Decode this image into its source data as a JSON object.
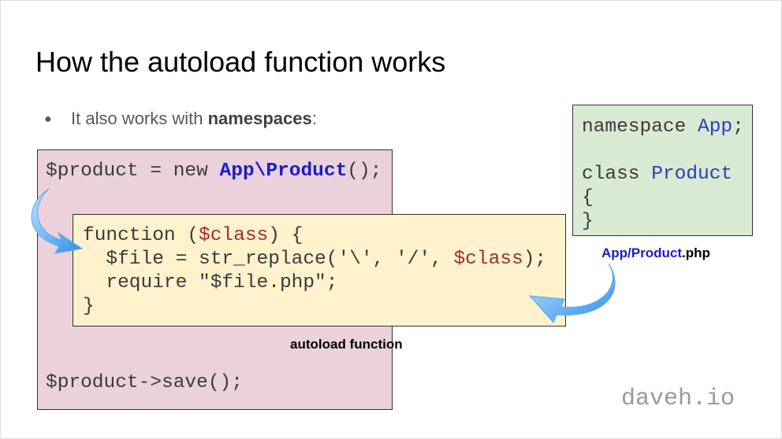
{
  "title": "How the autoload function works",
  "bullet": {
    "text": "It also works with ",
    "bold": "namespaces",
    "suffix": ":"
  },
  "caller": {
    "line1_a": "$product = new ",
    "line1_b": "App\\Product",
    "line1_c": "();",
    "line2": "$product->save();"
  },
  "autoload": {
    "l1_a": "function (",
    "l1_b": "$class",
    "l1_c": ") {",
    "l2_a": "  $file = str_replace('\\', '/', ",
    "l2_b": "$class",
    "l2_c": ");",
    "l3": "  require \"$file.php\";",
    "l4": "}",
    "caption": "autoload function"
  },
  "classfile": {
    "l1_a": "namespace ",
    "l1_b": "App",
    "l1_c": ";",
    "l3_a": "class ",
    "l3_b": "Product",
    "l4": "{",
    "l5": "}",
    "caption_a": "App/Product",
    "caption_b": ".php"
  },
  "watermark": "daveh.io"
}
